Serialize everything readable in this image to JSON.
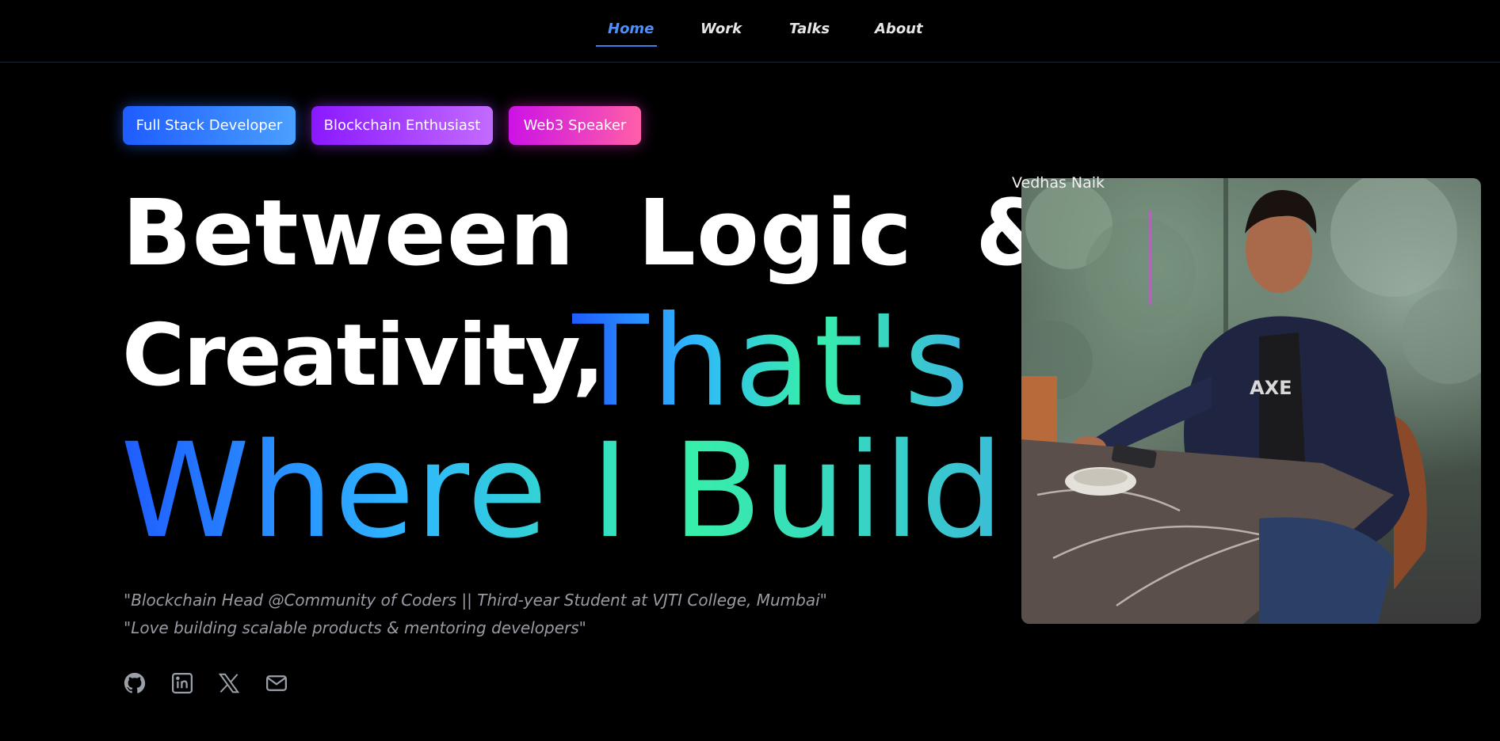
{
  "nav": {
    "items": [
      {
        "label": "Home",
        "active": true
      },
      {
        "label": "Work",
        "active": false
      },
      {
        "label": "Talks",
        "active": false
      },
      {
        "label": "About",
        "active": false
      }
    ],
    "active_color": "#4f8ff7"
  },
  "badges": [
    {
      "label": "Full Stack Developer"
    },
    {
      "label": "Blockchain Enthusiast"
    },
    {
      "label": "Web3 Speaker"
    }
  ],
  "hero": {
    "line1": "Between Logic &",
    "line2": "Creativity,",
    "line2_accent": "That's",
    "line3": "Where I Build!",
    "gradient_colors": [
      "#1f5cff",
      "#2fb6ff",
      "#37f0a8",
      "#3ab5e0"
    ]
  },
  "quotes": [
    "\"Blockchain Head @Community of Coders || Third-year Student at VJTI College, Mumbai\"",
    "\"Love building scalable products & mentoring developers\""
  ],
  "social": [
    {
      "icon": "github-icon"
    },
    {
      "icon": "linkedin-icon"
    },
    {
      "icon": "x-icon"
    },
    {
      "icon": "mail-icon"
    }
  ],
  "profile": {
    "image_alt": "Vedhas Naik"
  }
}
